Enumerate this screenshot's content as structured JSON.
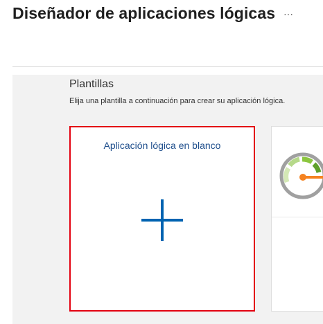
{
  "header": {
    "title": "Diseñador de aplicaciones lógicas",
    "more_label": "···"
  },
  "templates": {
    "section_title": "Plantillas",
    "section_subtitle": "Elija una plantilla a continuación para crear su aplicación lógica.",
    "cards": [
      {
        "label": "Aplicación lógica en blanco",
        "icon": "plus-icon",
        "selected": true
      },
      {
        "label": "",
        "icon": "gauge-icon",
        "selected": false
      }
    ]
  },
  "colors": {
    "selected_border": "#e3000f",
    "accent_blue": "#0063b1",
    "card_title": "#1e4e8c",
    "panel_background": "#f2f2f2",
    "gauge_green": "#8cc63f",
    "gauge_needle": "#f58220"
  }
}
